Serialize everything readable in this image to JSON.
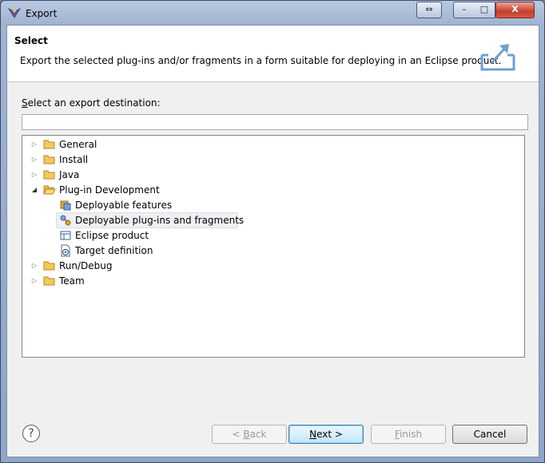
{
  "window": {
    "title": "Export"
  },
  "banner": {
    "title": "Select",
    "description": "Export the selected plug-ins and/or fragments in a form suitable for deploying in an Eclipse product."
  },
  "destination": {
    "label_mnemonic": "S",
    "label_rest": "elect an export destination:",
    "filter_value": ""
  },
  "tree": {
    "nodes": [
      {
        "label": "General",
        "expanded": false,
        "icon": "folder-icon"
      },
      {
        "label": "Install",
        "expanded": false,
        "icon": "folder-icon"
      },
      {
        "label": "Java",
        "expanded": false,
        "icon": "folder-icon"
      },
      {
        "label": "Plug-in Development",
        "expanded": true,
        "icon": "folder-open-icon"
      },
      {
        "label": "Deployable features",
        "icon": "deployable-features-icon"
      },
      {
        "label": "Deployable plug-ins and fragments",
        "icon": "deployable-plugins-icon",
        "selected": true
      },
      {
        "label": "Eclipse product",
        "icon": "eclipse-product-icon"
      },
      {
        "label": "Target definition",
        "icon": "target-definition-icon"
      },
      {
        "label": "Run/Debug",
        "expanded": false,
        "icon": "folder-icon"
      },
      {
        "label": "Team",
        "expanded": false,
        "icon": "folder-icon"
      }
    ]
  },
  "buttons": {
    "back_prefix": "< ",
    "back_mnemonic": "B",
    "back_rest": "ack",
    "next_mnemonic": "N",
    "next_rest": "ext >",
    "finish_mnemonic": "F",
    "finish_rest": "inish",
    "cancel": "Cancel"
  },
  "titlebar_buttons": {
    "restore": "⇔",
    "minimize": "–",
    "maximize": "□",
    "close": "X"
  },
  "help_icon": "?",
  "colors": {
    "folder": "#f5c85a",
    "selection": "#eef0f3",
    "default_button_border": "#3c7fb1"
  }
}
